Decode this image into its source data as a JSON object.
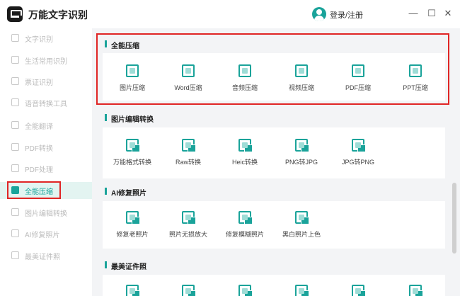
{
  "app": {
    "title": "万能文字识别",
    "login": "登录/注册"
  },
  "window": {
    "minimize": "—",
    "maximize": "☐",
    "close": "✕"
  },
  "sidebar": {
    "items": [
      {
        "label": "文字识别"
      },
      {
        "label": "生活常用识别"
      },
      {
        "label": "票证识别"
      },
      {
        "label": "语音转换工具"
      },
      {
        "label": "全能翻译"
      },
      {
        "label": "PDF转换"
      },
      {
        "label": "PDF处理"
      },
      {
        "label": "全能压缩",
        "active": true
      },
      {
        "label": "图片编辑转换"
      },
      {
        "label": "AI修复照片"
      },
      {
        "label": "最美证件照"
      }
    ]
  },
  "sections": [
    {
      "title": "全能压缩",
      "tools": [
        "图片压缩",
        "Word压缩",
        "音频压缩",
        "视频压缩",
        "PDF压缩",
        "PPT压缩"
      ]
    },
    {
      "title": "图片编辑转换",
      "tools": [
        "万能格式转换",
        "Raw转换",
        "Heic转换",
        "PNG转JPG",
        "JPG转PNG"
      ]
    },
    {
      "title": "AI修复照片",
      "tools": [
        "修复老照片",
        "照片无损放大",
        "修复模糊照片",
        "黑白照片上色"
      ]
    },
    {
      "title": "最美证件照",
      "tools": []
    }
  ],
  "colors": {
    "accent": "#1aa39a",
    "highlight": "#e02525"
  }
}
